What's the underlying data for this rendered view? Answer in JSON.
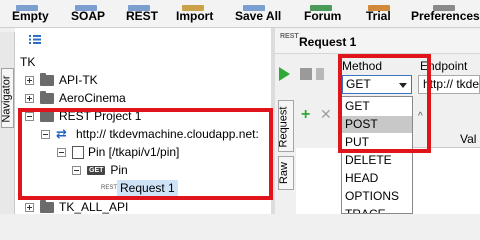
{
  "toolbar": {
    "buttons": [
      "Empty",
      "SOAP",
      "REST",
      "Import",
      "Save All",
      "Forum",
      "Trial",
      "Preferences"
    ]
  },
  "navigator": {
    "tab_label": "Navigator",
    "root": "TK",
    "items": [
      {
        "label": "API-TK",
        "icon": "folder-icon"
      },
      {
        "label": "AeroCinema",
        "icon": "folder-icon"
      },
      {
        "label": "REST Project 1",
        "icon": "folder-icon"
      },
      {
        "label": "http:// tkdevmachine.cloudapp.net:",
        "icon": "endpoint-arrows-icon"
      },
      {
        "label": "Pin [/tkapi/v1/pin]",
        "icon": "resource-icon"
      },
      {
        "label": "Pin",
        "icon": "get-method-icon",
        "badge": "GET"
      },
      {
        "label": "Request 1",
        "icon": "rest-request-icon",
        "badge": "REST"
      },
      {
        "label": "TK_ALL_API",
        "icon": "folder-icon"
      }
    ]
  },
  "request": {
    "badge": "REST",
    "title": "Request 1",
    "side_tabs": [
      "Request",
      "Raw"
    ],
    "method_label": "Method",
    "endpoint_label": "Endpoint",
    "method_value": "GET",
    "endpoint_value": "http:// tkde",
    "table_header_value": "Val",
    "method_options": [
      "GET",
      "POST",
      "PUT",
      "DELETE",
      "HEAD",
      "OPTIONS",
      "TRACE"
    ],
    "highlighted_option": "POST"
  },
  "colors": {
    "highlight": "#e0151b",
    "play": "#2fa935",
    "selection": "#cfe3f7"
  }
}
